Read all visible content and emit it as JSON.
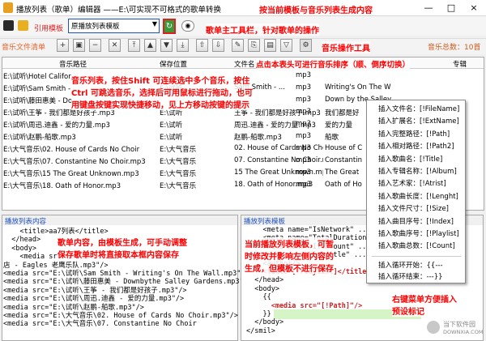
{
  "window": {
    "title": "播放列表（歌单）编辑器 ——E:\\可实现不可格式的歌单转换",
    "controls": [
      "—",
      "□",
      "×"
    ]
  },
  "toolbar": {
    "template_label": "引用模板",
    "template_value": "原播放列表模板",
    "refresh_icon": "refresh-icon",
    "view_icon": "eye-icon"
  },
  "notes": {
    "refresh": "按当前模板与音乐列表生成内容",
    "main_toolbar": "歌单主工具栏，针对歌单的操作",
    "music_tools": "音乐操作工具",
    "header_sort": "点击本表头可进行音乐排序（顺、倒序切换）",
    "list_help_1": "音乐列表，按住Shift 可连续选中多个音乐，按住",
    "list_help_2": "Ctrl 可跳选音乐，选择后可用鼠标进行拖动，也可",
    "list_help_3": "用键盘按键实现快捷移动，见上方移动按键的提示",
    "content_help_1": "歌单内容，由模板生成，可手动调整",
    "content_help_2": "保存歌单时将直接取本框内容保存",
    "tmpl_help_1": "当前播放列表模板，可暂",
    "tmpl_help_2": "时修改并影响左侧内容的",
    "tmpl_help_3": "生成，但模板不进行保存",
    "ctx_help_1": "右键菜单方便插入",
    "ctx_help_2": "预设标记"
  },
  "music_section": {
    "label": "音乐文件清单",
    "total": "音乐总数：10首"
  },
  "table": {
    "headers": [
      "音乐路径",
      "保存位置",
      "文件名",
      "格式",
      "专辑"
    ],
    "rows": [
      {
        "path": "E:\\试听\\Hotel Califor...",
        "loc": "",
        "name": "",
        "fmt": "mp3",
        "album": ""
      },
      {
        "path": "E:\\试听\\Sam Smith - ...",
        "loc": "E:\\试听",
        "name": "Sam Smith - ...",
        "fmt": "mp3",
        "album": "Writing's On The W"
      },
      {
        "path": "E:\\试听\\藤田惠美 - Do...",
        "loc": "",
        "name": "",
        "fmt": "mp3",
        "album": "Down by the Salley"
      },
      {
        "path": "E:\\试听\\王筝 - 我们都是好孩子.mp3",
        "loc": "E:\\试听",
        "name": "王筝 - 我们都是好孩子.mp3",
        "fmt": "mp3",
        "album": "我们都是好"
      },
      {
        "path": "E:\\试听\\周迅.迪鑫 - 爱的力量.mp3",
        "loc": "E:\\试听",
        "name": "周迅.迪鑫 - 爱的力量.mp3",
        "fmt": "mp3",
        "album": "爱的力量"
      },
      {
        "path": "E:\\试听\\赵鹏-船歌.mp3",
        "loc": "E:\\试听",
        "name": "赵鹏-船歌.mp3",
        "fmt": "mp3",
        "album": "船歌"
      },
      {
        "path": "E:\\大气音乐\\02. House of Cards No Choir",
        "loc": "E:\\大气音乐",
        "name": "02. House of Cards No Choir",
        "fmt": "mp3",
        "album": "House of C"
      },
      {
        "path": "E:\\大气音乐\\07. Constantine No Choir.mp3",
        "loc": "E:\\大气音乐",
        "name": "07. Constantine No Choir.mp3",
        "fmt": "mp3",
        "album": "Constantin"
      },
      {
        "path": "E:\\大气音乐\\15 The Great Unknown.mp3",
        "loc": "E:\\大气音乐",
        "name": "15 The Great Unknown.mp3",
        "fmt": "mp3",
        "album": "The Great"
      },
      {
        "path": "E:\\大气音乐\\18. Oath of Honor.mp3",
        "loc": "E:\\大气音乐",
        "name": "18. Oath of Honor.mp3",
        "fmt": "mp3",
        "album": "Oath of Ho"
      }
    ]
  },
  "context_menu": {
    "items": [
      "插入文件名：[!FileName]",
      "插入扩展名：[!ExtName]",
      "插入完整路径：[!Path]",
      "插入相对路径：[!Path2]",
      "插入歌曲名：[!Title]",
      "插入专辑名称：[!Album]",
      "插入艺术家：[!Atrist]",
      "插入歌曲长度：[!Lenght]",
      "插入文件尺寸：[!Size]",
      "插入曲目序号：[!Index]",
      "插入歌曲序号：[!Playlist]",
      "插入歌曲总数：[!Count]"
    ],
    "loop_items": [
      "插入循环开始：{{---",
      "插入循环结束：---}}"
    ]
  },
  "playlist_content": {
    "title": "播放列表内容",
    "lines": [
      "    <title>aa7列表</title>",
      "  </head>",
      "  <body>",
      "    <media src=\"E:\\试听\\Hotel California",
      "店 - Eagles 老鹰乐队.mp3\"/>",
      "<media src=\"E:\\试听\\Sam Smith - Writing's On The Wall.mp3\"/>",
      "<media src=\"E:\\试听\\藤田惠美 - Downbythe Salley Gardens.mp3\"/>",
      "<media src=\"E:\\试听\\王筝 - 我们都是好孩子.mp3\"/>",
      "<media src=\"E:\\试听\\周迅.迪鑫 - 爱的力量.mp3\"/>",
      "<media src=\"E:\\试听\\赵鹏-船歌.mp3\"/>",
      "<media src=\"E:\\大气音乐\\02. House of Cards No Choir.mp3\"/>",
      "<media src=\"E:\\大气音乐\\07. Constantine No Choir"
    ]
  },
  "playlist_template": {
    "title": "播放列表模板",
    "lines": [
      "    <meta name=\"IsNetwork\" ...",
      "    <meta name=\"TotalDuration\" ...",
      "    <meta name=\"ItemCount\" ...",
      "    <meta name=\"Subtitle\" ...",
      "    <author/>",
      "    <title>[!Playlist]</title>",
      "  </head>",
      "  <body>",
      "    {{",
      "      <media src=\"[!Path]\"/>",
      "    }}",
      "  </body>",
      "</smil>"
    ]
  },
  "watermark": {
    "text": "当下软件园",
    "sub": "DOWNXIA.COM"
  }
}
